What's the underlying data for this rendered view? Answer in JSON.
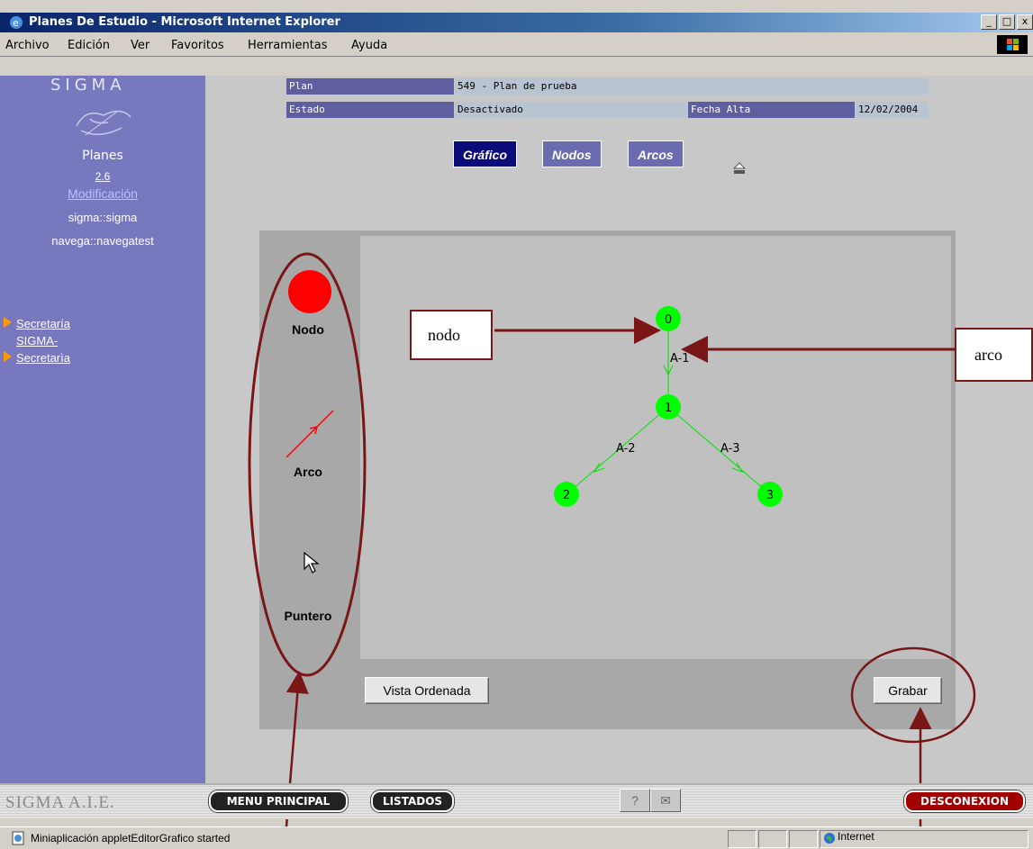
{
  "window": {
    "title": "Planes De Estudio - Microsoft Internet Explorer",
    "controls": [
      "_",
      "□",
      "x"
    ]
  },
  "menubar": {
    "items": [
      "Archivo",
      "Edición",
      "Ver",
      "Favoritos",
      "Herramientas",
      "Ayuda"
    ]
  },
  "sidebar": {
    "brand": "SIGMA",
    "app_name": "Planes",
    "version": "2.6",
    "mode": "Modificación",
    "user1": "sigma::sigma",
    "user2": "navega::navegatest",
    "links": [
      {
        "label": "Secretaría"
      },
      {
        "label": "SIGMA-"
      },
      {
        "label": "Secretarìa"
      }
    ]
  },
  "plan_info": {
    "plan_label": "Plan",
    "plan_value": "549 - Plan de prueba",
    "estado_label": "Estado",
    "estado_value": "Desactivado",
    "fecha_label": "Fecha Alta",
    "fecha_value": "12/02/2004"
  },
  "tabs": [
    {
      "label": "Gráfico",
      "active": true
    },
    {
      "label": "Nodos",
      "active": false
    },
    {
      "label": "Arcos",
      "active": false
    }
  ],
  "toolbox": {
    "nodo": "Nodo",
    "arco": "Arco",
    "puntero": "Puntero"
  },
  "graph": {
    "nodes": [
      "0",
      "1",
      "2",
      "3"
    ],
    "arcs": [
      "A-1",
      "A-2",
      "A-3"
    ]
  },
  "buttons": {
    "vista": "Vista Ordenada",
    "grabar": "Grabar"
  },
  "annotations": {
    "nodo": "nodo",
    "arco": "arco"
  },
  "footer": {
    "brand": "SIGMA A.I.E.",
    "menu_principal": "MENU PRINCIPAL",
    "listados": "LISTADOS",
    "help": "?",
    "mail": "✉",
    "desconexion": "DESCONEXION"
  },
  "statusbar": {
    "text": "Miniaplicación appletEditorGrafico started",
    "zone": "Internet"
  },
  "colors": {
    "sidebar": "#7878bf",
    "node_green": "#00ff00",
    "node_tool_red": "#ff0000",
    "annotation": "#7a1616"
  }
}
